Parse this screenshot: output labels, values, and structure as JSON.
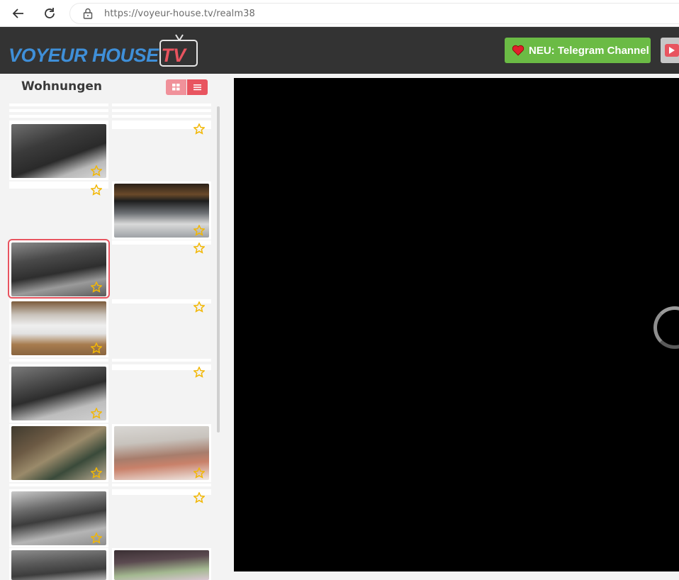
{
  "browser": {
    "url_scheme": "https://",
    "url_host": "voyeur-house.tv",
    "url_path": "/realm38"
  },
  "header": {
    "logo_word": "VOYEUR HOUSE",
    "logo_tv": "TV",
    "telegram_label": "NEU: Telegram Channel",
    "colors": {
      "header_bg": "#333333",
      "brand_blue": "#3f8fd8",
      "brand_red": "#e8545f",
      "telegram_green": "#6bbb45"
    }
  },
  "sidebar": {
    "title": "Wohnungen",
    "view_toggle": [
      "grid-icon",
      "list-icon"
    ],
    "rooms": [
      {
        "id": "room-1",
        "kind": "camera",
        "scene": "dark-bedroom",
        "favorite": false
      },
      {
        "id": "room-2",
        "kind": "empty",
        "favorite": false
      },
      {
        "id": "room-3",
        "kind": "empty",
        "favorite": false
      },
      {
        "id": "room-4",
        "kind": "camera",
        "scene": "living-room-couch",
        "favorite": false
      },
      {
        "id": "room-5",
        "kind": "camera",
        "scene": "dark-living-room",
        "favorite": false,
        "selected": true
      },
      {
        "id": "room-6",
        "kind": "empty",
        "favorite": false
      },
      {
        "id": "room-7",
        "kind": "camera",
        "scene": "kitchen",
        "favorite": false
      },
      {
        "id": "room-8",
        "kind": "empty",
        "favorite": false
      },
      {
        "id": "room-9",
        "kind": "camera",
        "scene": "dark-bedroom",
        "favorite": false
      },
      {
        "id": "room-10",
        "kind": "empty",
        "favorite": false
      },
      {
        "id": "room-11",
        "kind": "camera",
        "scene": "bedroom-sleeping",
        "favorite": false
      },
      {
        "id": "room-12",
        "kind": "camera",
        "scene": "bedroom-sleeping",
        "favorite": false
      },
      {
        "id": "room-13",
        "kind": "camera",
        "scene": "dark-bedroom",
        "favorite": false
      },
      {
        "id": "room-14",
        "kind": "empty",
        "favorite": false
      },
      {
        "id": "room-15",
        "kind": "camera",
        "scene": "dark-room",
        "favorite": false
      },
      {
        "id": "room-16",
        "kind": "camera",
        "scene": "bedroom",
        "favorite": false
      }
    ]
  },
  "player": {
    "state": "loading"
  }
}
